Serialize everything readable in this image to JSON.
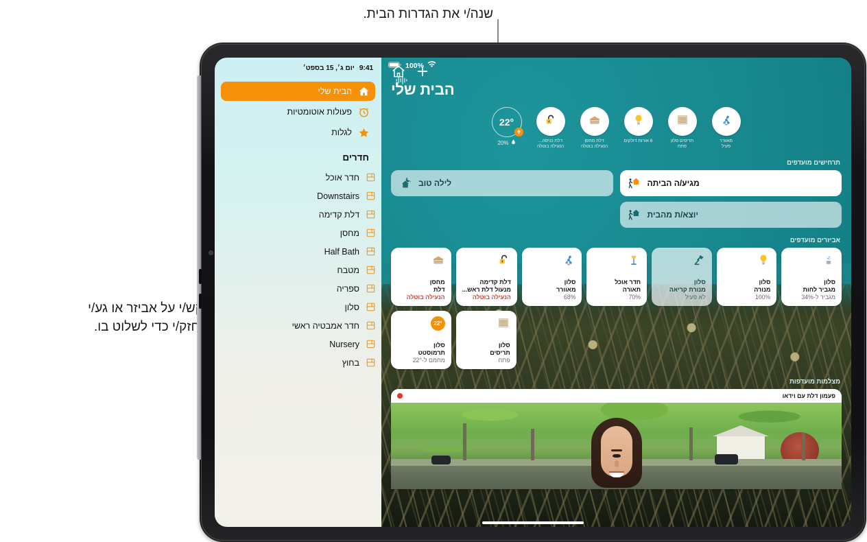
{
  "callouts": {
    "top": "שנה/י את הגדרות הבית.",
    "left": "הקש/י על אביזר או גע/י\nוהחזק/י כדי לשלוט בו."
  },
  "ipad_statusbar": {
    "time": "9:41",
    "date": "יום ג׳, 15 בספט׳"
  },
  "app_statusbar": {
    "battery": "100%",
    "wifi_icon": "wifi-icon",
    "siri_icon": "siri-waveform-icon"
  },
  "header": {
    "title": "הבית שלי",
    "add_button": "+",
    "home_settings_icon": "home-outline-icon"
  },
  "sidebar": {
    "top_items": [
      {
        "label": "הבית שלי",
        "icon": "house-filled-icon",
        "active": true
      },
      {
        "label": "פעולות אוטומטיות",
        "icon": "clock-icon",
        "active": false
      },
      {
        "label": "לגלות",
        "icon": "star-icon",
        "active": false
      }
    ],
    "rooms_heading": "חדרים",
    "rooms": [
      {
        "label": "חדר אוכל",
        "icon": "room-icon"
      },
      {
        "label": "Downstairs",
        "icon": "room-icon"
      },
      {
        "label": "דלת קדימה",
        "icon": "room-icon"
      },
      {
        "label": "מחסן",
        "icon": "room-icon"
      },
      {
        "label": "Half Bath",
        "icon": "room-icon"
      },
      {
        "label": "מטבח",
        "icon": "room-icon"
      },
      {
        "label": "ספריה",
        "icon": "room-icon"
      },
      {
        "label": "סלון",
        "icon": "room-icon"
      },
      {
        "label": "חדר אמבטיה ראשי",
        "icon": "room-icon"
      },
      {
        "label": "Nursery",
        "icon": "room-icon"
      },
      {
        "label": "בחוץ",
        "icon": "room-icon"
      }
    ]
  },
  "status_row": {
    "items": [
      {
        "icon": "fan-icon",
        "line1": "מאוורר",
        "line2": "פעיל"
      },
      {
        "icon": "blinds-icon",
        "line1": "תריסים סלון",
        "line2": "פתח"
      },
      {
        "icon": "bulb-icon",
        "line1": "6 אורות דולקים",
        "line2": ""
      },
      {
        "icon": "garage-icon",
        "line1": "דלת מחסן",
        "line2": "הנעילה בוטלה"
      },
      {
        "icon": "lock-open-icon",
        "line1": "דלת כניסה...",
        "line2": "הנעילה בוטלה"
      }
    ],
    "climate": {
      "temperature": "22°",
      "humidity": "20%",
      "humidity_icon": "droplet-icon",
      "badge_icon": "heat-up-icon"
    }
  },
  "sections": {
    "scenes": "תרחישים מועדפים",
    "accessories": "אביזרים מועדפים",
    "cameras": "מצלמות מועדפות"
  },
  "scenes": [
    {
      "label": "מגיע/ה הביתה",
      "icon": "arrive-home-icon",
      "state": "on"
    },
    {
      "label": "לילה טוב",
      "icon": "good-night-icon",
      "state": "off"
    },
    {
      "label": "יוצא/ת מהבית",
      "icon": "leave-home-icon",
      "state": "off"
    }
  ],
  "accessories_row1": [
    {
      "room": "סלון",
      "name": "מגביר לחות",
      "state": "מגביר ל-34%",
      "icon": "humidifier-icon",
      "on": true,
      "alert": false
    },
    {
      "room": "סלון",
      "name": "מנורה",
      "state": "100%",
      "icon": "bulb-icon",
      "on": true,
      "alert": false
    },
    {
      "room": "סלון",
      "name": "מנורת קריאה",
      "state": "לא פעיל",
      "icon": "desk-lamp-icon",
      "on": false,
      "alert": false
    },
    {
      "room": "חדר אוכל",
      "name": "תאורה",
      "state": "70%",
      "icon": "floor-lamp-icon",
      "on": true,
      "alert": false
    },
    {
      "room": "סלון",
      "name": "מאוורר",
      "state": "68%",
      "icon": "fan-icon",
      "on": true,
      "alert": false
    },
    {
      "room": "דלת קדימה",
      "name": "מנעול דלת ראש...",
      "state": "הנעילה בוטלה",
      "icon": "lock-open-icon",
      "on": true,
      "alert": true
    },
    {
      "room": "מחסן",
      "name": "דלת",
      "state": "הנעילה בוטלה",
      "icon": "garage-icon",
      "on": true,
      "alert": true
    }
  ],
  "accessories_row2": [
    {
      "room": "סלון",
      "name": "תריסים",
      "state": "פתח",
      "icon": "blinds-icon",
      "on": true,
      "alert": false
    },
    {
      "room": "סלון",
      "name": "תרמוסטט",
      "state": "מחמם ל-22°",
      "icon": "thermostat-badge",
      "badge": "22°",
      "on": true,
      "alert": false
    }
  ],
  "camera": {
    "title": "פעמון דלת עם וידאו",
    "recording_icon": "record-dot-icon"
  },
  "colors": {
    "accent_orange": "#f79009",
    "teal_background": "#17878d",
    "sidebar_top": "#cdf0f2",
    "alert_red": "#e1392d",
    "white": "#ffffff"
  }
}
